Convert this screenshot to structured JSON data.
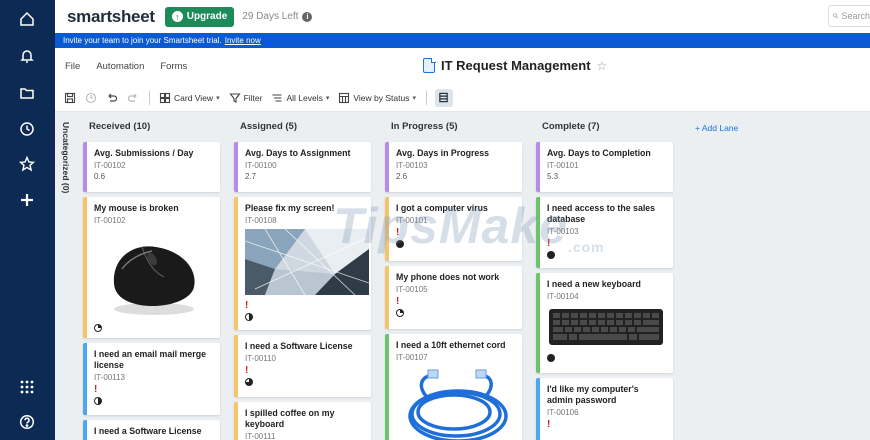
{
  "app": {
    "logo": "smartsheet",
    "upgrade_label": "Upgrade",
    "trial_text": "29 Days Left",
    "search_placeholder": "Search"
  },
  "invite_bar": {
    "text": "Invite your team to join your Smartsheet trial.",
    "link": "Invite now"
  },
  "menu": [
    "File",
    "Automation",
    "Forms"
  ],
  "sheet_title": "IT Request Management",
  "toolbar": {
    "card_view": "Card View",
    "filter": "Filter",
    "levels": "All Levels",
    "view_by": "View by Status"
  },
  "rail_icons": [
    "home-icon",
    "bell-icon",
    "folder-icon",
    "clock-icon",
    "star-icon",
    "plus-icon",
    "apps-grid-icon",
    "help-icon"
  ],
  "uncategorized": "Uncategorized (0)",
  "add_lane": "+ Add Lane",
  "lanes": [
    {
      "title": "Received (10)",
      "cards": [
        {
          "title": "Avg. Submissions / Day",
          "id": "IT-00102",
          "value": "0.6",
          "color": "#b68ce8"
        },
        {
          "title": "My mouse is broken",
          "id": "IT-00102",
          "color": "#f5c46b"
        },
        {
          "title": "I need an email mail merge license",
          "id": "IT-00113",
          "color": "#4aa8f0"
        },
        {
          "title": "I need a Software License",
          "color": "#4aa8f0"
        }
      ]
    },
    {
      "title": "Assigned (5)",
      "cards": [
        {
          "title": "Avg. Days to Assignment",
          "id": "IT-00100",
          "value": "2.7",
          "color": "#b68ce8"
        },
        {
          "title": "Please fix my screen!",
          "id": "IT-00108",
          "color": "#f5c46b"
        },
        {
          "title": "I need a Software License",
          "id": "IT-00110",
          "color": "#f5c46b"
        },
        {
          "title": "I spilled coffee on my keyboard",
          "id": "IT-00111",
          "color": "#f5c46b"
        }
      ]
    },
    {
      "title": "In Progress (5)",
      "cards": [
        {
          "title": "Avg. Days in Progress",
          "id": "IT-00103",
          "value": "2.6",
          "color": "#b68ce8"
        },
        {
          "title": "I got a computer virus",
          "id": "IT-00101",
          "color": "#f5c46b"
        },
        {
          "title": "My phone does not work",
          "id": "IT-00105",
          "color": "#f5c46b"
        },
        {
          "title": "I need a 10ft ethernet cord",
          "id": "IT-00107",
          "color": "#6cc56a"
        }
      ]
    },
    {
      "title": "Complete (7)",
      "cards": [
        {
          "title": "Avg. Days to Completion",
          "id": "IT-00101",
          "value": "5.3",
          "color": "#b68ce8"
        },
        {
          "title": "I need access to the sales database",
          "id": "IT-00103",
          "color": "#6cc56a"
        },
        {
          "title": "I need a new keyboard",
          "id": "IT-00104",
          "color": "#6cc56a"
        },
        {
          "title": "I'd like my computer's admin password",
          "id": "IT-00106",
          "color": "#4aa8f0"
        }
      ]
    }
  ],
  "priority_mark": "!",
  "watermark": {
    "main": "TipsMake",
    "suffix": ".com"
  }
}
